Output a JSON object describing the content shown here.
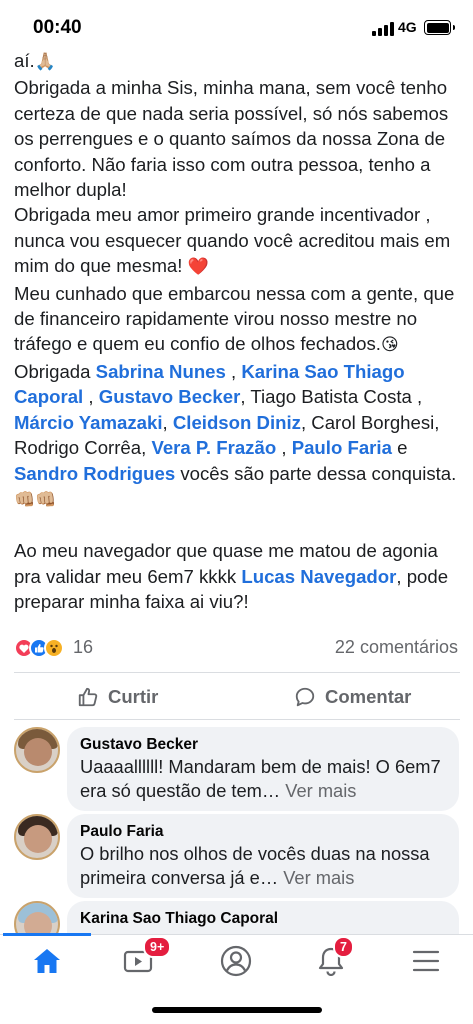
{
  "status_bar": {
    "time": "00:40",
    "network": "4G"
  },
  "post": {
    "paragraphs": [
      [
        {
          "t": "aí."
        },
        {
          "t": "🙏🏼",
          "emoji": true
        }
      ],
      [
        {
          "t": "Obrigada a minha Sis, minha mana, sem você tenho certeza de que nada seria possível, só nós sabemos os perrengues e o quanto saímos da nossa Zona de conforto. Não faria isso com outra pessoa, tenho a melhor dupla!"
        }
      ],
      [
        {
          "t": "Obrigada meu amor primeiro grande incentivador , nunca vou esquecer quando você acreditou mais em mim do que mesma! "
        },
        {
          "t": "❤️",
          "emoji": true,
          "heart": true
        }
      ],
      [
        {
          "t": "Meu cunhado que embarcou nessa com a gente, que de financeiro rapidamente virou nosso mestre no tráfego e quem eu confio de olhos fechados."
        },
        {
          "t": "😘",
          "emoji": true
        }
      ],
      [
        {
          "t": "Obrigada "
        },
        {
          "t": "Sabrina Nunes",
          "mention": true
        },
        {
          "t": " , "
        },
        {
          "t": "Karina Sao Thiago Caporal",
          "mention": true
        },
        {
          "t": " , "
        },
        {
          "t": "Gustavo Becker",
          "mention": true
        },
        {
          "t": ", Tiago Batista Costa  , "
        },
        {
          "t": "Márcio Yamazaki",
          "mention": true
        },
        {
          "t": ", "
        },
        {
          "t": "Cleidson Diniz",
          "mention": true
        },
        {
          "t": ",  Carol Borghesi, Rodrigo Corrêa, "
        },
        {
          "t": "Vera P. Frazão",
          "mention": true
        },
        {
          "t": " , "
        },
        {
          "t": "Paulo Faria",
          "mention": true
        },
        {
          "t": " e "
        },
        {
          "t": "Sandro Rodrigues",
          "mention": true
        },
        {
          "t": " vocês são parte dessa conquista."
        },
        {
          "t": "👊🏼👊🏼",
          "emoji": true
        }
      ],
      [],
      [
        {
          "t": "Ao meu navegador que quase me matou de agonia pra validar meu 6em7 kkkk "
        },
        {
          "t": "Lucas Navegador",
          "mention": true
        },
        {
          "t": ", pode preparar minha faixa ai viu?!"
        }
      ]
    ]
  },
  "reactions": {
    "count": "16",
    "comments_label": "22 comentários"
  },
  "actions": {
    "like_label": "Curtir",
    "comment_label": "Comentar"
  },
  "comments": [
    {
      "name": "Gustavo Becker",
      "text": "Uaaaallllll! Mandaram bem de mais! O 6em7 era só questão de tem…",
      "see_more": "Ver mais"
    },
    {
      "name": "Paulo Faria",
      "text": "O brilho nos olhos de vocês duas na nossa primeira conversa já e…",
      "see_more": "Ver mais"
    },
    {
      "name": "Karina Sao Thiago Caporal",
      "text": "",
      "see_more": ""
    }
  ],
  "tabbar": {
    "items": [
      "home-icon",
      "video-icon",
      "profile-icon",
      "notifications-icon",
      "menu-icon"
    ],
    "video_badge": "9+",
    "notifications_badge": "7",
    "active_color": "#1877f2"
  }
}
